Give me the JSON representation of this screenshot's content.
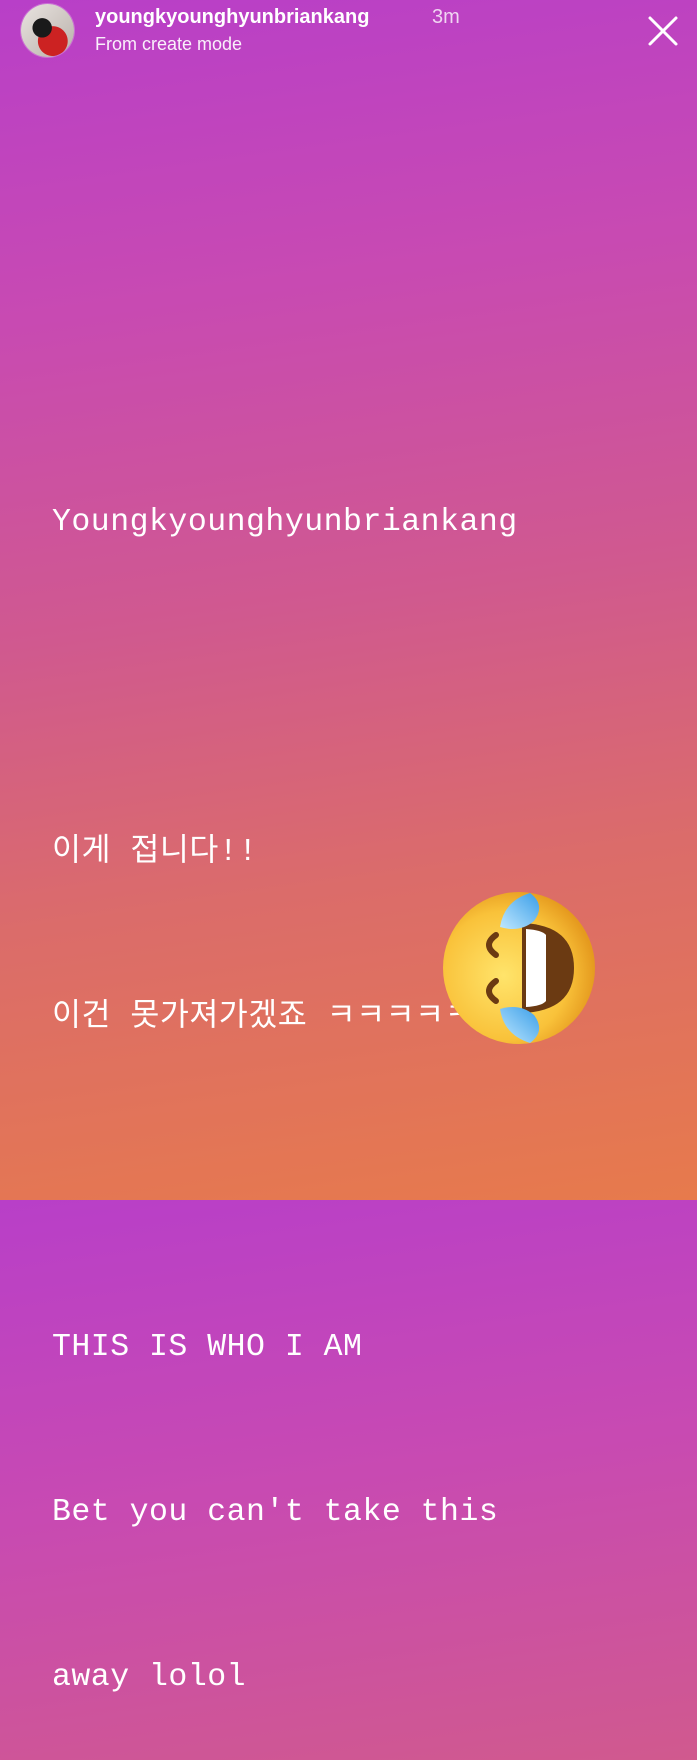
{
  "header": {
    "username": "youngkyounghyunbriankang",
    "time": "3m",
    "subtitle": "From create mode"
  },
  "icons": {
    "avatar": "profile-avatar",
    "close": "close-icon",
    "sticker": "face-with-tears-of-joy-emoji"
  },
  "story": {
    "line1": "Youngkyounghyunbriankang",
    "line2": "이게 접니다!!",
    "line3": "이건 못가져가겠죠 ㅋㅋㅋㅋㅋ",
    "line4": "THIS IS WHO I AM",
    "line5": "Bet you can't take this",
    "line6": "away lolol"
  },
  "colors": {
    "gradient_top": "#b83fc8",
    "gradient_bottom": "#e77a4c",
    "text": "#ffffff"
  }
}
